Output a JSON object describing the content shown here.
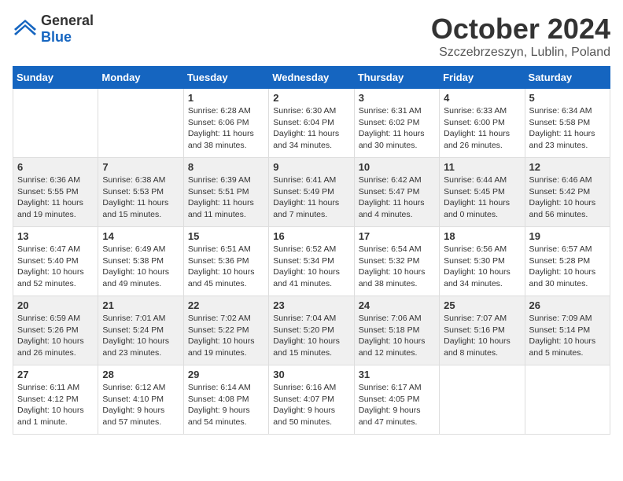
{
  "logo": {
    "general": "General",
    "blue": "Blue"
  },
  "header": {
    "month": "October 2024",
    "location": "Szczebrzeszyn, Lublin, Poland"
  },
  "weekdays": [
    "Sunday",
    "Monday",
    "Tuesday",
    "Wednesday",
    "Thursday",
    "Friday",
    "Saturday"
  ],
  "weeks": [
    [
      {
        "day": "",
        "info": ""
      },
      {
        "day": "",
        "info": ""
      },
      {
        "day": "1",
        "info": "Sunrise: 6:28 AM\nSunset: 6:06 PM\nDaylight: 11 hours\nand 38 minutes."
      },
      {
        "day": "2",
        "info": "Sunrise: 6:30 AM\nSunset: 6:04 PM\nDaylight: 11 hours\nand 34 minutes."
      },
      {
        "day": "3",
        "info": "Sunrise: 6:31 AM\nSunset: 6:02 PM\nDaylight: 11 hours\nand 30 minutes."
      },
      {
        "day": "4",
        "info": "Sunrise: 6:33 AM\nSunset: 6:00 PM\nDaylight: 11 hours\nand 26 minutes."
      },
      {
        "day": "5",
        "info": "Sunrise: 6:34 AM\nSunset: 5:58 PM\nDaylight: 11 hours\nand 23 minutes."
      }
    ],
    [
      {
        "day": "6",
        "info": "Sunrise: 6:36 AM\nSunset: 5:55 PM\nDaylight: 11 hours\nand 19 minutes."
      },
      {
        "day": "7",
        "info": "Sunrise: 6:38 AM\nSunset: 5:53 PM\nDaylight: 11 hours\nand 15 minutes."
      },
      {
        "day": "8",
        "info": "Sunrise: 6:39 AM\nSunset: 5:51 PM\nDaylight: 11 hours\nand 11 minutes."
      },
      {
        "day": "9",
        "info": "Sunrise: 6:41 AM\nSunset: 5:49 PM\nDaylight: 11 hours\nand 7 minutes."
      },
      {
        "day": "10",
        "info": "Sunrise: 6:42 AM\nSunset: 5:47 PM\nDaylight: 11 hours\nand 4 minutes."
      },
      {
        "day": "11",
        "info": "Sunrise: 6:44 AM\nSunset: 5:45 PM\nDaylight: 11 hours\nand 0 minutes."
      },
      {
        "day": "12",
        "info": "Sunrise: 6:46 AM\nSunset: 5:42 PM\nDaylight: 10 hours\nand 56 minutes."
      }
    ],
    [
      {
        "day": "13",
        "info": "Sunrise: 6:47 AM\nSunset: 5:40 PM\nDaylight: 10 hours\nand 52 minutes."
      },
      {
        "day": "14",
        "info": "Sunrise: 6:49 AM\nSunset: 5:38 PM\nDaylight: 10 hours\nand 49 minutes."
      },
      {
        "day": "15",
        "info": "Sunrise: 6:51 AM\nSunset: 5:36 PM\nDaylight: 10 hours\nand 45 minutes."
      },
      {
        "day": "16",
        "info": "Sunrise: 6:52 AM\nSunset: 5:34 PM\nDaylight: 10 hours\nand 41 minutes."
      },
      {
        "day": "17",
        "info": "Sunrise: 6:54 AM\nSunset: 5:32 PM\nDaylight: 10 hours\nand 38 minutes."
      },
      {
        "day": "18",
        "info": "Sunrise: 6:56 AM\nSunset: 5:30 PM\nDaylight: 10 hours\nand 34 minutes."
      },
      {
        "day": "19",
        "info": "Sunrise: 6:57 AM\nSunset: 5:28 PM\nDaylight: 10 hours\nand 30 minutes."
      }
    ],
    [
      {
        "day": "20",
        "info": "Sunrise: 6:59 AM\nSunset: 5:26 PM\nDaylight: 10 hours\nand 26 minutes."
      },
      {
        "day": "21",
        "info": "Sunrise: 7:01 AM\nSunset: 5:24 PM\nDaylight: 10 hours\nand 23 minutes."
      },
      {
        "day": "22",
        "info": "Sunrise: 7:02 AM\nSunset: 5:22 PM\nDaylight: 10 hours\nand 19 minutes."
      },
      {
        "day": "23",
        "info": "Sunrise: 7:04 AM\nSunset: 5:20 PM\nDaylight: 10 hours\nand 15 minutes."
      },
      {
        "day": "24",
        "info": "Sunrise: 7:06 AM\nSunset: 5:18 PM\nDaylight: 10 hours\nand 12 minutes."
      },
      {
        "day": "25",
        "info": "Sunrise: 7:07 AM\nSunset: 5:16 PM\nDaylight: 10 hours\nand 8 minutes."
      },
      {
        "day": "26",
        "info": "Sunrise: 7:09 AM\nSunset: 5:14 PM\nDaylight: 10 hours\nand 5 minutes."
      }
    ],
    [
      {
        "day": "27",
        "info": "Sunrise: 6:11 AM\nSunset: 4:12 PM\nDaylight: 10 hours\nand 1 minute."
      },
      {
        "day": "28",
        "info": "Sunrise: 6:12 AM\nSunset: 4:10 PM\nDaylight: 9 hours\nand 57 minutes."
      },
      {
        "day": "29",
        "info": "Sunrise: 6:14 AM\nSunset: 4:08 PM\nDaylight: 9 hours\nand 54 minutes."
      },
      {
        "day": "30",
        "info": "Sunrise: 6:16 AM\nSunset: 4:07 PM\nDaylight: 9 hours\nand 50 minutes."
      },
      {
        "day": "31",
        "info": "Sunrise: 6:17 AM\nSunset: 4:05 PM\nDaylight: 9 hours\nand 47 minutes."
      },
      {
        "day": "",
        "info": ""
      },
      {
        "day": "",
        "info": ""
      }
    ]
  ]
}
